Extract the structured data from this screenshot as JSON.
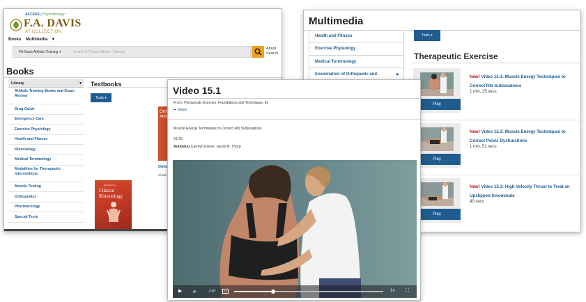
{
  "books_window": {
    "brand": {
      "top": "ACCESS",
      "top_accent": "Physiotherapy",
      "main": "F.A. DAVIS",
      "sub": "AT COLLECTION"
    },
    "nav": [
      "Books",
      "Multimedia"
    ],
    "search": {
      "scope": "FA Davis Athletic Training",
      "placeholder": "Search FA Davis Athletic Training",
      "about_link": "About Search"
    },
    "page_title": "Books",
    "sidebar_heading": "Library",
    "sidebar_items": [
      "Athletic Training Books and Exam Review",
      "Drug Guide",
      "Emergency Care",
      "Exercise Physiology",
      "Health and Fitness",
      "Kinesiology",
      "Medical Terminology",
      "Modalities for Therapeutic Interventions",
      "Muscle Testing",
      "Orthopedics",
      "Pharmacology",
      "Special Tests"
    ],
    "section_title": "Textbooks",
    "tools_label": "Tools",
    "book1": {
      "cover_text": "Orth Athl",
      "caption": "Ortho Exam",
      "author": "Chad St"
    },
    "book2": {
      "cover_small": "Brunnstrom's",
      "cover_title": "Clinical Kinesiology"
    }
  },
  "multimedia_window": {
    "title": "Multimedia",
    "sidebar_items": [
      "Health and Fitness",
      "Exercise Physiology",
      "Medical Terminology",
      "Examination of Orthopedic and"
    ],
    "tools_label": "Tools",
    "section_title": "Therapeutic Exercise",
    "videos": [
      {
        "new_label": "New!",
        "title": "Video 15.1: Muscle Energy Techniques to Correct Rib Subluxations",
        "duration": "1 min, 25 secs",
        "play_label": "Play"
      },
      {
        "new_label": "New!",
        "title": "Video 15.2: Muscle Energy Techniques to Correct Pelvic Dysfunctions",
        "duration": "1 min, 51 secs",
        "play_label": "Play"
      },
      {
        "new_label": "New!",
        "title": "Video 15.3: High Velocity Thrust to Treat an Upslipped Innominate",
        "duration": "40 secs",
        "play_label": "Play"
      }
    ]
  },
  "video_window": {
    "title": "Video 15.1",
    "from": "From: Therapeutic Exercise: Foundations and Techniques, 6e",
    "share_label": "Share",
    "description": "Muscle Energy Techniques to Correct Rib Subluxations",
    "length": "01:25",
    "authors_label": "Author(s)",
    "authors": "Carolyn Kisner, Jacob N. Thorp",
    "player": {
      "elapsed": "-1:07",
      "progress": 0.26,
      "speed": "1x",
      "cc_label": "CC"
    }
  }
}
